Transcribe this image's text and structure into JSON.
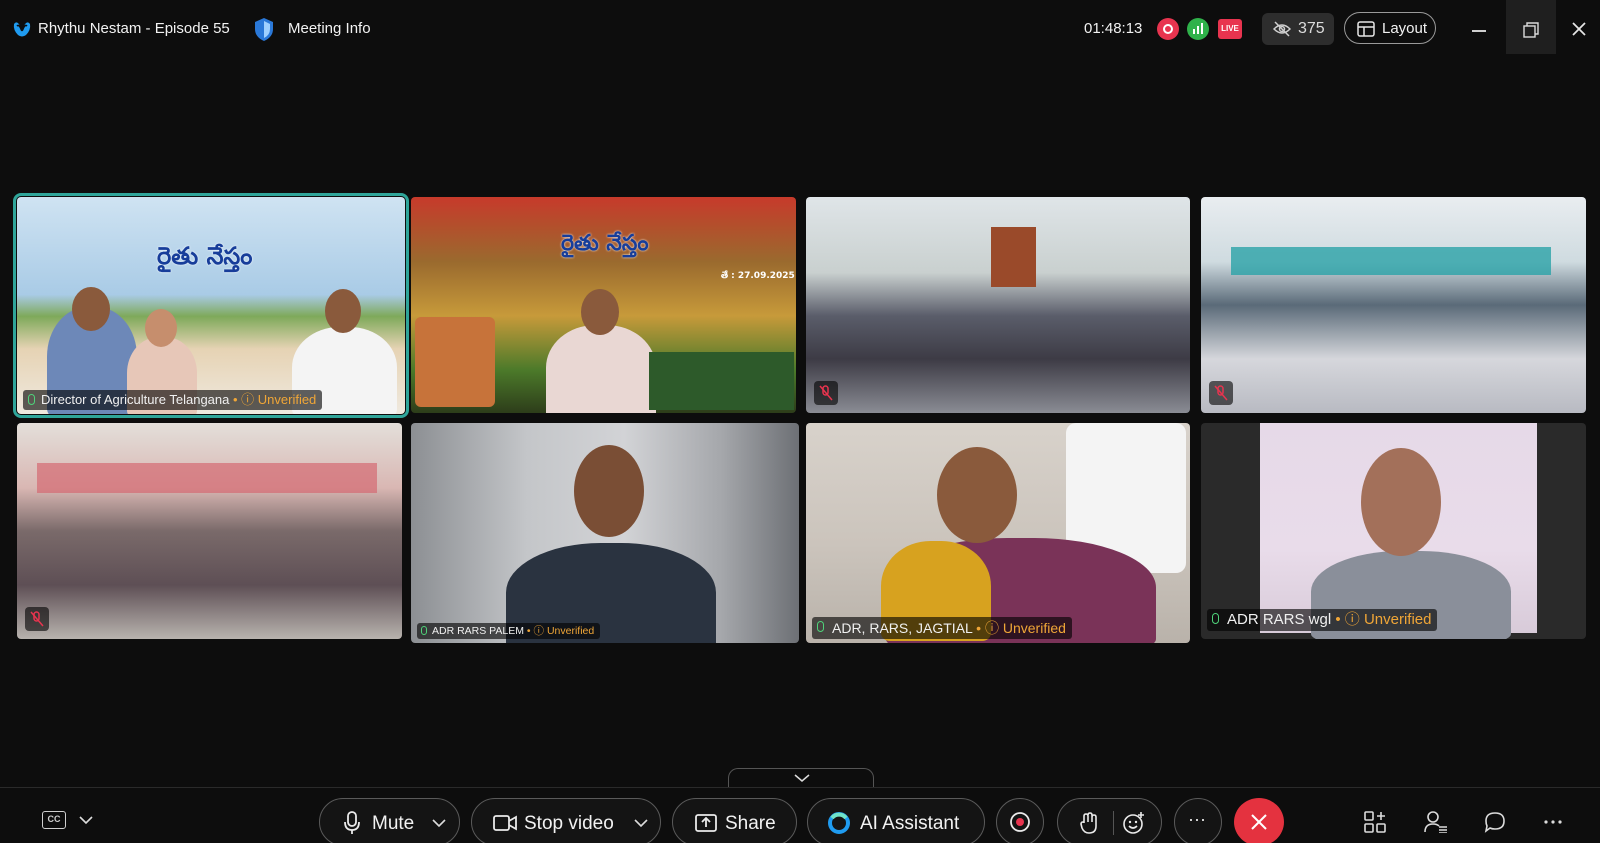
{
  "header": {
    "meeting_title": "Rhythu Nestam - Episode 55",
    "meeting_info_label": "Meeting Info",
    "timer": "01:48:13",
    "live_label": "LIVE",
    "viewer_count": "375",
    "layout_label": "Layout"
  },
  "banner": {
    "title": "రైతు నేస్తం",
    "date": "తే : 27.09.2025"
  },
  "tiles": [
    {
      "name": "Director of Agriculture Telangana",
      "status": "Unverified",
      "muted": false,
      "active": true
    },
    {
      "name": "",
      "status": "",
      "muted": false,
      "active": false
    },
    {
      "name": "",
      "status": "",
      "muted": true,
      "active": false
    },
    {
      "name": "",
      "status": "",
      "muted": true,
      "active": false
    },
    {
      "name": "",
      "status": "",
      "muted": true,
      "active": false
    },
    {
      "name": "ADR RARS PALEM",
      "status": "Unverified",
      "muted": false,
      "active": false
    },
    {
      "name": "ADR, RARS, JAGTIAL",
      "status": "Unverified",
      "muted": false,
      "active": false
    },
    {
      "name": "ADR RARS wgl",
      "status": "Unverified",
      "muted": false,
      "active": false
    }
  ],
  "controls": {
    "cc_label": "CC",
    "mute_label": "Mute",
    "stop_video_label": "Stop video",
    "share_label": "Share",
    "ai_assistant_label": "AI Assistant",
    "more_label": "···"
  },
  "colors": {
    "accent_teal": "#2fa59a",
    "record_red": "#e8344f",
    "signal_green": "#2fb24a",
    "end_red": "#e4323f",
    "unverified_orange": "#f0a637"
  }
}
